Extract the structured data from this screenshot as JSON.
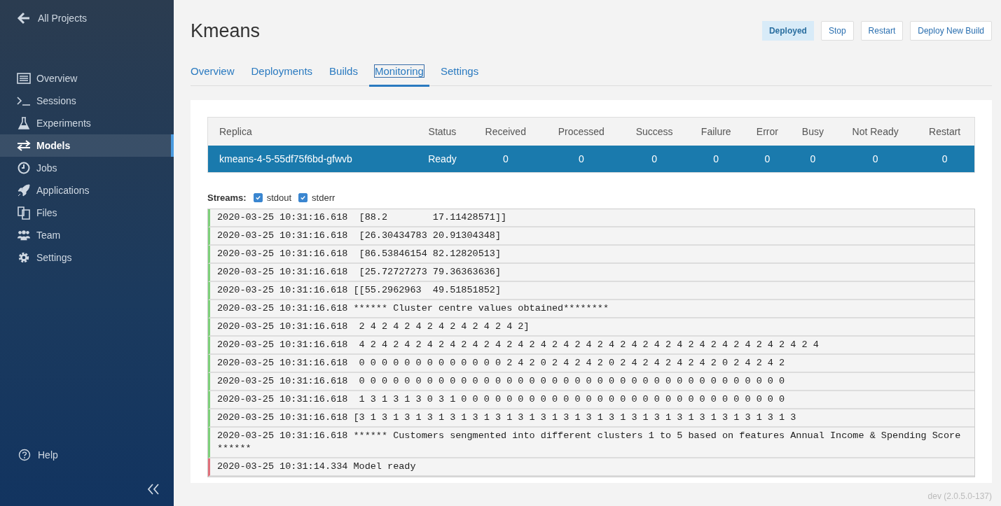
{
  "sidebar": {
    "back_link": "All Projects",
    "items": [
      {
        "label": "Overview",
        "selected": false
      },
      {
        "label": "Sessions",
        "selected": false
      },
      {
        "label": "Experiments",
        "selected": false
      },
      {
        "label": "Models",
        "selected": true
      },
      {
        "label": "Jobs",
        "selected": false
      },
      {
        "label": "Applications",
        "selected": false
      },
      {
        "label": "Files",
        "selected": false
      },
      {
        "label": "Team",
        "selected": false
      },
      {
        "label": "Settings",
        "selected": false
      }
    ],
    "help": "Help"
  },
  "header": {
    "title": "Kmeans",
    "status": "Deployed",
    "buttons": [
      "Stop",
      "Restart",
      "Deploy New Build"
    ]
  },
  "tabs": [
    {
      "label": "Overview",
      "selected": false
    },
    {
      "label": "Deployments",
      "selected": false
    },
    {
      "label": "Builds",
      "selected": false
    },
    {
      "label": "Monitoring",
      "selected": true
    },
    {
      "label": "Settings",
      "selected": false
    }
  ],
  "table": {
    "columns": [
      "Replica",
      "Status",
      "Received",
      "Processed",
      "Success",
      "Failure",
      "Error",
      "Busy",
      "Not Ready",
      "Restart"
    ],
    "rows": [
      {
        "selected": true,
        "cells": [
          "kmeans-4-5-55df75f6bd-gfwvb",
          "Ready",
          "0",
          "0",
          "0",
          "0",
          "0",
          "0",
          "0",
          "0"
        ]
      }
    ]
  },
  "streams": {
    "label": "Streams:",
    "options": [
      {
        "label": "stdout",
        "checked": true
      },
      {
        "label": "stderr",
        "checked": true
      }
    ]
  },
  "log": [
    {
      "kind": "stdout",
      "text": "2020-03-25 10:31:16.618  [88.2        17.11428571]]"
    },
    {
      "kind": "stdout",
      "text": "2020-03-25 10:31:16.618  [26.30434783 20.91304348]"
    },
    {
      "kind": "stdout",
      "text": "2020-03-25 10:31:16.618  [86.53846154 82.12820513]"
    },
    {
      "kind": "stdout",
      "text": "2020-03-25 10:31:16.618  [25.72727273 79.36363636]"
    },
    {
      "kind": "stdout",
      "text": "2020-03-25 10:31:16.618 [[55.2962963  49.51851852]"
    },
    {
      "kind": "stdout",
      "text": "2020-03-25 10:31:16.618 ****** Cluster centre values obtained********"
    },
    {
      "kind": "stdout",
      "text": "2020-03-25 10:31:16.618  2 4 2 4 2 4 2 4 2 4 2 4 2 4 2]"
    },
    {
      "kind": "stdout",
      "text": "2020-03-25 10:31:16.618  4 2 4 2 4 2 4 2 4 2 4 2 4 2 4 2 4 2 4 2 4 2 4 2 4 2 4 2 4 2 4 2 4 2 4 2 4 2 4 2 4"
    },
    {
      "kind": "stdout",
      "text": "2020-03-25 10:31:16.618  0 0 0 0 0 0 0 0 0 0 0 0 0 2 4 2 0 2 4 2 4 2 0 2 4 2 4 2 4 2 4 2 0 2 4 2 4 2"
    },
    {
      "kind": "stdout",
      "text": "2020-03-25 10:31:16.618  0 0 0 0 0 0 0 0 0 0 0 0 0 0 0 0 0 0 0 0 0 0 0 0 0 0 0 0 0 0 0 0 0 0 0 0 0 0"
    },
    {
      "kind": "stdout",
      "text": "2020-03-25 10:31:16.618  1 3 1 3 1 3 0 3 1 0 0 0 0 0 0 0 0 0 0 0 0 0 0 0 0 0 0 0 0 0 0 0 0 0 0 0 0 0"
    },
    {
      "kind": "stdout",
      "text": "2020-03-25 10:31:16.618 [3 1 3 1 3 1 3 1 3 1 3 1 3 1 3 1 3 1 3 1 3 1 3 1 3 1 3 1 3 1 3 1 3 1 3 1 3 1 3"
    },
    {
      "kind": "stdout",
      "text": "2020-03-25 10:31:16.618 ****** Customers sengmented into different clusters 1 to 5 based on features Annual Income & Spending Score ******"
    },
    {
      "kind": "stderr",
      "text": "2020-03-25 10:31:14.334 Model ready"
    }
  ],
  "version": "dev (2.0.5.0-137)"
}
